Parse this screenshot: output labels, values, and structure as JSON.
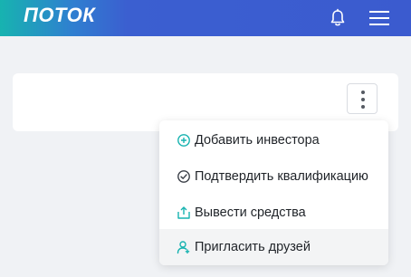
{
  "header": {
    "logo": "ПОТОК",
    "icons": {
      "notifications": "bell-icon",
      "menu": "hamburger-menu-icon"
    }
  },
  "card": {
    "more_button_icon": "vertical-dots-icon"
  },
  "dropdown": {
    "items": [
      {
        "label": "Добавить инвестора",
        "icon": "plus-circle-icon"
      },
      {
        "label": "Подтвердить квалификацию",
        "icon": "check-circle-icon"
      },
      {
        "label": "Вывести средства",
        "icon": "withdraw-icon"
      },
      {
        "label": "Пригласить друзей",
        "icon": "invite-user-icon",
        "highlighted": true
      }
    ]
  },
  "colors": {
    "header_start": "#17b3b0",
    "header_end": "#3b5bcf",
    "accent": "#17b3b0",
    "background": "#f0f2f5"
  }
}
